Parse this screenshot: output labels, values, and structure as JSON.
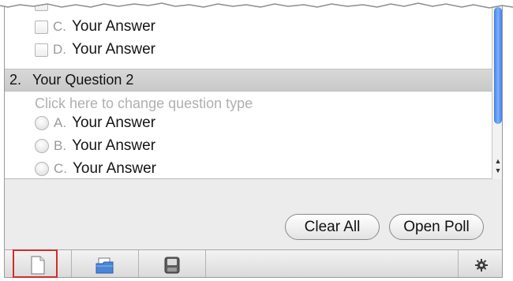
{
  "options_top": [
    {
      "letter": "C.",
      "text": "Your Answer"
    },
    {
      "letter": "D.",
      "text": "Your Answer"
    }
  ],
  "question": {
    "number": "2.",
    "title": "Your Question 2",
    "type_hint": "Click here to change question type",
    "options": [
      {
        "letter": "A.",
        "text": "Your Answer"
      },
      {
        "letter": "B.",
        "text": "Your Answer"
      },
      {
        "letter": "C.",
        "text": "Your Answer"
      }
    ]
  },
  "buttons": {
    "clear_all": "Clear All",
    "open_poll": "Open Poll"
  },
  "toolbar": {
    "icons": [
      "new-document-icon",
      "open-folder-icon",
      "save-disk-icon",
      "gear-icon"
    ],
    "highlight_color": "#d42b2b"
  },
  "colors": {
    "scroll_thumb": "#3f7fe0",
    "header_bg": "#d0d0d0"
  }
}
